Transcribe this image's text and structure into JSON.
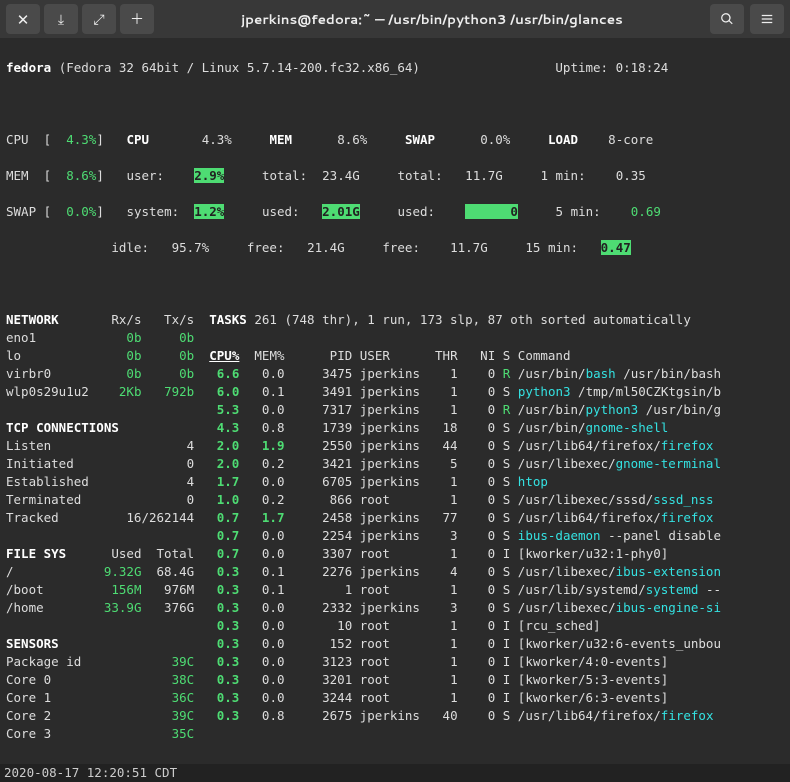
{
  "window": {
    "title": "jperkins@fedora:~ — /usr/bin/python3 /usr/bin/glances"
  },
  "header": {
    "hostname": "fedora",
    "os": "(Fedora 32 64bit / Linux 5.7.14-200.fc32.x86_64)",
    "uptime_label": "Uptime:",
    "uptime": "0:18:24"
  },
  "summary": {
    "cpu_left": {
      "label": "CPU  [",
      "val": "4.3%",
      "close": "]"
    },
    "mem_left": {
      "label": "MEM  [",
      "val": "8.6%",
      "close": "]"
    },
    "swap_left": {
      "label": "SWAP [",
      "val": "0.0%",
      "close": "]"
    },
    "cpu": {
      "label": "CPU",
      "pct": "4.3%",
      "user_l": "user:",
      "user_v": "2.9%",
      "sys_l": "system:",
      "sys_v": "1.2%",
      "idle_l": "idle:",
      "idle_v": "95.7%"
    },
    "mem": {
      "label": "MEM",
      "pct": "8.6%",
      "total_l": "total:",
      "total_v": "23.4G",
      "used_l": "used:",
      "used_v": "2.01G",
      "free_l": "free:",
      "free_v": "21.4G"
    },
    "swap": {
      "label": "SWAP",
      "pct": "0.0%",
      "total_l": "total:",
      "total_v": "11.7G",
      "used_l": "used:",
      "used_v": "0",
      "free_l": "free:",
      "free_v": "11.7G"
    },
    "load": {
      "label": "LOAD",
      "core": "8-core",
      "l1": "1 min:",
      "v1": "0.35",
      "l5": "5 min:",
      "v5": "0.69",
      "l15": "15 min:",
      "v15": "0.47"
    }
  },
  "network": {
    "header": "NETWORK",
    "rx": "Rx/s",
    "tx": "Tx/s",
    "rows": [
      {
        "if": "eno1",
        "rx": "0b",
        "tx": "0b"
      },
      {
        "if": "lo",
        "rx": "0b",
        "tx": "0b"
      },
      {
        "if": "virbr0",
        "rx": "0b",
        "tx": "0b"
      },
      {
        "if": "wlp0s29u1u2",
        "rx": "2Kb",
        "tx": "792b"
      }
    ]
  },
  "tcp": {
    "header": "TCP CONNECTIONS",
    "rows": [
      {
        "l": "Listen",
        "v": "4"
      },
      {
        "l": "Initiated",
        "v": "0"
      },
      {
        "l": "Established",
        "v": "4"
      },
      {
        "l": "Terminated",
        "v": "0"
      },
      {
        "l": "Tracked",
        "v": "16/262144"
      }
    ]
  },
  "fs": {
    "header": "FILE SYS",
    "used_h": "Used",
    "total_h": "Total",
    "rows": [
      {
        "m": "/",
        "used": "9.32G",
        "total": "68.4G"
      },
      {
        "m": "/boot",
        "used": "156M",
        "total": "976M"
      },
      {
        "m": "/home",
        "used": "33.9G",
        "total": "376G"
      }
    ]
  },
  "sensors": {
    "header": "SENSORS",
    "rows": [
      {
        "l": "Package id",
        "v": "39C"
      },
      {
        "l": "Core 0",
        "v": "38C"
      },
      {
        "l": "Core 1",
        "v": "36C"
      },
      {
        "l": "Core 2",
        "v": "39C"
      },
      {
        "l": "Core 3",
        "v": "35C"
      }
    ]
  },
  "tasks": {
    "header": "TASKS",
    "summary": "261 (748 thr), 1 run, 173 slp, 87 oth sorted automatically",
    "cols": {
      "cpu": "CPU%",
      "mem": "MEM%",
      "pid": "PID",
      "user": "USER",
      "thr": "THR",
      "ni": "NI",
      "s": "S",
      "cmd": "Command"
    },
    "rows": [
      {
        "cpu": "6.6",
        "mem": "0.0",
        "pid": "3475",
        "user": "jperkins",
        "thr": "1",
        "ni": "0",
        "s": "R",
        "cmd_pre": "/usr/bin/",
        "cmd_hl": "bash",
        "cmd_post": " /usr/bin/bash"
      },
      {
        "cpu": "6.0",
        "mem": "0.1",
        "pid": "3491",
        "user": "jperkins",
        "thr": "1",
        "ni": "0",
        "s": "S",
        "cmd_pre": "",
        "cmd_hl": "python3",
        "cmd_post": " /tmp/ml50CZKtgsin/b"
      },
      {
        "cpu": "5.3",
        "mem": "0.0",
        "pid": "7317",
        "user": "jperkins",
        "thr": "1",
        "ni": "0",
        "s": "R",
        "cmd_pre": "/usr/bin/",
        "cmd_hl": "python3",
        "cmd_post": " /usr/bin/g"
      },
      {
        "cpu": "4.3",
        "mem": "0.8",
        "pid": "1739",
        "user": "jperkins",
        "thr": "18",
        "ni": "0",
        "s": "S",
        "cmd_pre": "/usr/bin/",
        "cmd_hl": "gnome-shell",
        "cmd_post": ""
      },
      {
        "cpu": "2.0",
        "mem": "1.9",
        "pid": "2550",
        "user": "jperkins",
        "thr": "44",
        "ni": "0",
        "s": "S",
        "cmd_pre": "/usr/lib64/firefox/",
        "cmd_hl": "firefox",
        "cmd_post": ""
      },
      {
        "cpu": "2.0",
        "mem": "0.2",
        "pid": "3421",
        "user": "jperkins",
        "thr": "5",
        "ni": "0",
        "s": "S",
        "cmd_pre": "/usr/libexec/",
        "cmd_hl": "gnome-terminal",
        "cmd_post": ""
      },
      {
        "cpu": "1.7",
        "mem": "0.0",
        "pid": "6705",
        "user": "jperkins",
        "thr": "1",
        "ni": "0",
        "s": "S",
        "cmd_pre": "",
        "cmd_hl": "htop",
        "cmd_post": ""
      },
      {
        "cpu": "1.0",
        "mem": "0.2",
        "pid": "866",
        "user": "root",
        "thr": "1",
        "ni": "0",
        "s": "S",
        "cmd_pre": "/usr/libexec/sssd/",
        "cmd_hl": "sssd_nss",
        "cmd_post": ""
      },
      {
        "cpu": "0.7",
        "mem": "1.7",
        "pid": "2458",
        "user": "jperkins",
        "thr": "77",
        "ni": "0",
        "s": "S",
        "cmd_pre": "/usr/lib64/firefox/",
        "cmd_hl": "firefox",
        "cmd_post": ""
      },
      {
        "cpu": "0.7",
        "mem": "0.0",
        "pid": "2254",
        "user": "jperkins",
        "thr": "3",
        "ni": "0",
        "s": "S",
        "cmd_pre": "",
        "cmd_hl": "ibus-daemon",
        "cmd_post": " --panel disable"
      },
      {
        "cpu": "0.7",
        "mem": "0.0",
        "pid": "3307",
        "user": "root",
        "thr": "1",
        "ni": "0",
        "s": "I",
        "cmd_pre": "[kworker/u32:1-phy0]",
        "cmd_hl": "",
        "cmd_post": ""
      },
      {
        "cpu": "0.3",
        "mem": "0.1",
        "pid": "2276",
        "user": "jperkins",
        "thr": "4",
        "ni": "0",
        "s": "S",
        "cmd_pre": "/usr/libexec/",
        "cmd_hl": "ibus-extension",
        "cmd_post": ""
      },
      {
        "cpu": "0.3",
        "mem": "0.1",
        "pid": "1",
        "user": "root",
        "thr": "1",
        "ni": "0",
        "s": "S",
        "cmd_pre": "/usr/lib/systemd/",
        "cmd_hl": "systemd",
        "cmd_post": " --"
      },
      {
        "cpu": "0.3",
        "mem": "0.0",
        "pid": "2332",
        "user": "jperkins",
        "thr": "3",
        "ni": "0",
        "s": "S",
        "cmd_pre": "/usr/libexec/",
        "cmd_hl": "ibus-engine-si",
        "cmd_post": ""
      },
      {
        "cpu": "0.3",
        "mem": "0.0",
        "pid": "10",
        "user": "root",
        "thr": "1",
        "ni": "0",
        "s": "I",
        "cmd_pre": "[rcu_sched]",
        "cmd_hl": "",
        "cmd_post": ""
      },
      {
        "cpu": "0.3",
        "mem": "0.0",
        "pid": "152",
        "user": "root",
        "thr": "1",
        "ni": "0",
        "s": "I",
        "cmd_pre": "[kworker/u32:6-events_unbou",
        "cmd_hl": "",
        "cmd_post": ""
      },
      {
        "cpu": "0.3",
        "mem": "0.0",
        "pid": "3123",
        "user": "root",
        "thr": "1",
        "ni": "0",
        "s": "I",
        "cmd_pre": "[kworker/4:0-events]",
        "cmd_hl": "",
        "cmd_post": ""
      },
      {
        "cpu": "0.3",
        "mem": "0.0",
        "pid": "3201",
        "user": "root",
        "thr": "1",
        "ni": "0",
        "s": "I",
        "cmd_pre": "[kworker/5:3-events]",
        "cmd_hl": "",
        "cmd_post": ""
      },
      {
        "cpu": "0.3",
        "mem": "0.0",
        "pid": "3244",
        "user": "root",
        "thr": "1",
        "ni": "0",
        "s": "I",
        "cmd_pre": "[kworker/6:3-events]",
        "cmd_hl": "",
        "cmd_post": ""
      },
      {
        "cpu": "0.3",
        "mem": "0.8",
        "pid": "2675",
        "user": "jperkins",
        "thr": "40",
        "ni": "0",
        "s": "S",
        "cmd_pre": "/usr/lib64/firefox/",
        "cmd_hl": "firefox",
        "cmd_post": ""
      }
    ]
  },
  "statusbar": "2020-08-17 12:20:51 CDT"
}
